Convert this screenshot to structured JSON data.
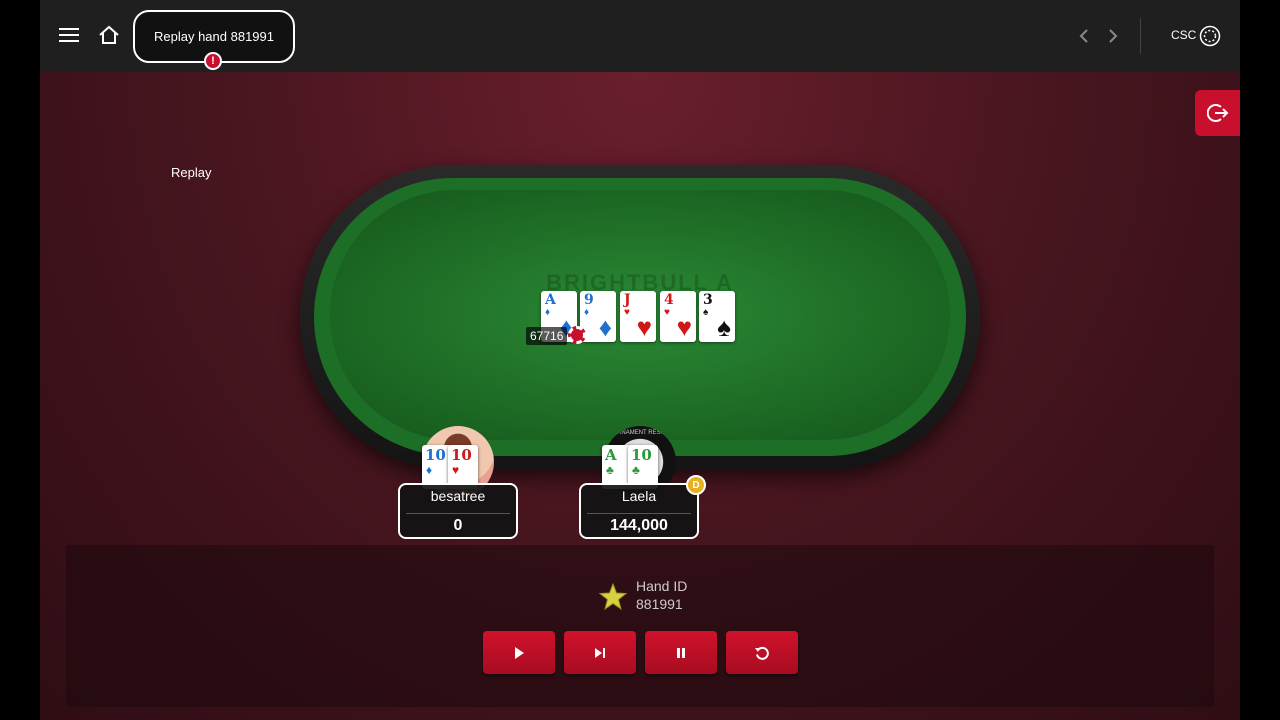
{
  "header": {
    "replay_title": "Replay hand 881991",
    "alert_symbol": "!",
    "currency": "CSC"
  },
  "view_label": "Replay",
  "table": {
    "logo_text": "BRIGHTBULL A",
    "pot": "67716",
    "board": [
      {
        "rank": "A",
        "suit": "♦",
        "color": "blue"
      },
      {
        "rank": "9",
        "suit": "♦",
        "color": "blue"
      },
      {
        "rank": "J",
        "suit": "♥",
        "color": "red"
      },
      {
        "rank": "4",
        "suit": "♥",
        "color": "red"
      },
      {
        "rank": "3",
        "suit": "♠",
        "color": "black"
      }
    ]
  },
  "players": [
    {
      "name": "besatree",
      "chips": "0",
      "cards": [
        {
          "rank": "10",
          "suit": "♦",
          "color": "blue"
        },
        {
          "rank": "10",
          "suit": "♥",
          "color": "red"
        }
      ]
    },
    {
      "name": "Laela",
      "chips": "144,000",
      "dealer": "D",
      "avatar_text": "TOURNAMENT RESULTS",
      "cards": [
        {
          "rank": "A",
          "suit": "♣",
          "color": "green"
        },
        {
          "rank": "10",
          "suit": "♣",
          "color": "green"
        }
      ]
    }
  ],
  "hand_info": {
    "label": "Hand ID",
    "value": "881991"
  },
  "colors": {
    "accent_red": "#c8102e",
    "felt_green": "#1d6e26",
    "background": "#4a1620"
  }
}
